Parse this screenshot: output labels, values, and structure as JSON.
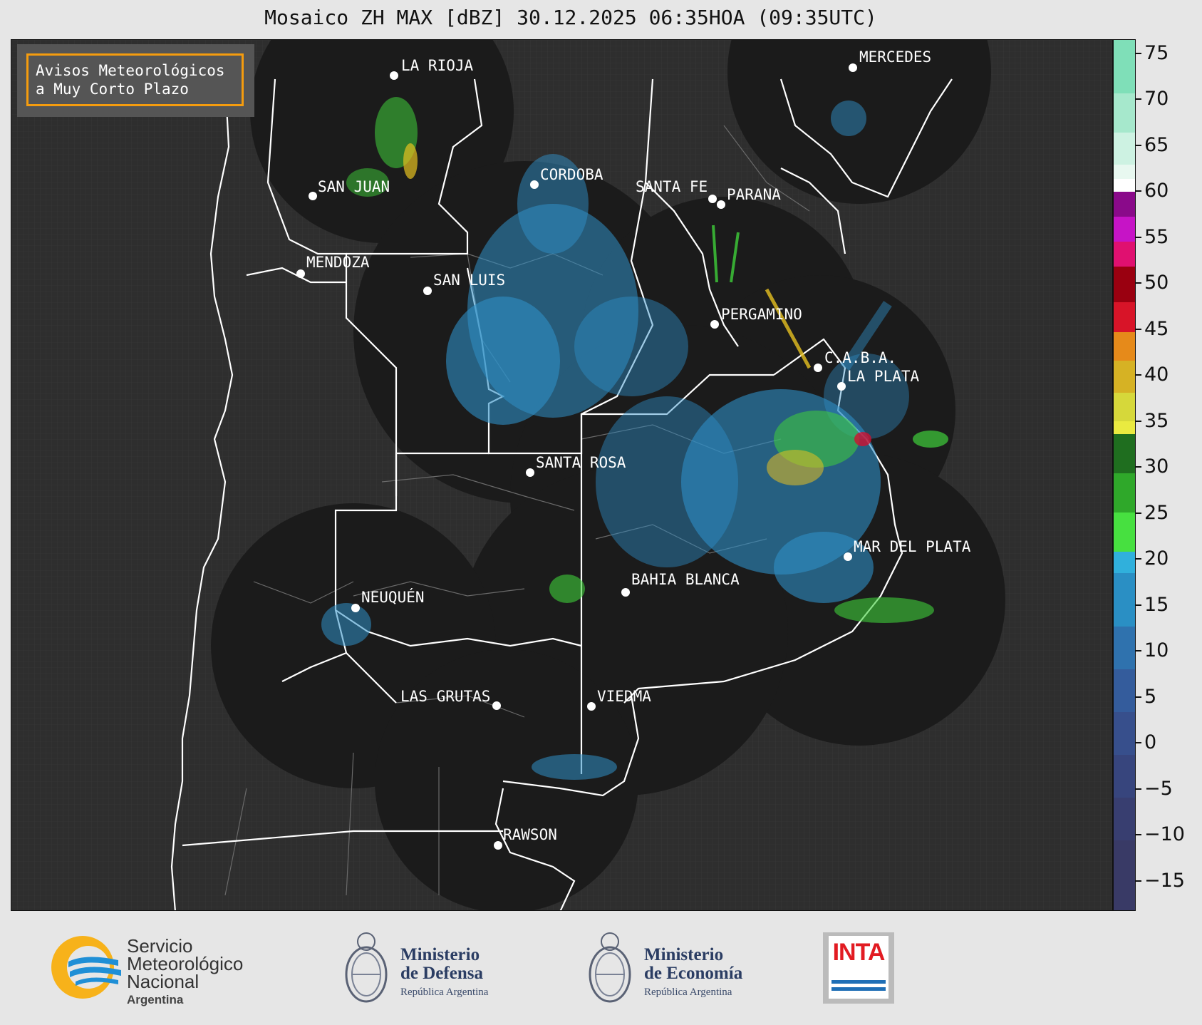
{
  "title": "Mosaico ZH MAX [dBZ] 30.12.2025 06:35HOA (09:35UTC)",
  "avisos": {
    "line1": "Avisos Meteorológicos",
    "line2": "a Muy Corto Plazo"
  },
  "cities": [
    {
      "name": "LA RIOJA"
    },
    {
      "name": "SAN JUAN"
    },
    {
      "name": "CORDOBA"
    },
    {
      "name": "SANTA FE"
    },
    {
      "name": "PARANA"
    },
    {
      "name": "MERCEDES"
    },
    {
      "name": "MENDOZA"
    },
    {
      "name": "SAN LUIS"
    },
    {
      "name": "PERGAMINO"
    },
    {
      "name": "C.A.B.A."
    },
    {
      "name": "LA PLATA"
    },
    {
      "name": "SANTA ROSA"
    },
    {
      "name": "MAR DEL PLATA"
    },
    {
      "name": "BAHIA BLANCA"
    },
    {
      "name": "NEUQUÉN"
    },
    {
      "name": "LAS GRUTAS"
    },
    {
      "name": "VIEDMA"
    },
    {
      "name": "RAWSON"
    }
  ],
  "colorbar": {
    "ticks": [
      "75",
      "70",
      "65",
      "60",
      "55",
      "50",
      "45",
      "40",
      "35",
      "30",
      "25",
      "20",
      "15",
      "10",
      "5",
      "0",
      "−5",
      "−10",
      "−15"
    ],
    "colors": {
      "map_background": "#2e2e2e",
      "radar_coverage": "#1b1b1b",
      "echo_low": "#2f8fc7",
      "echo_mid": "#3fcf3a",
      "echo_high": "#e6c020",
      "echo_max": "#d01030"
    }
  },
  "logos": {
    "smn": {
      "line1": "Servicio",
      "line2": "Meteorológico",
      "line3": "Nacional",
      "line4": "Argentina"
    },
    "defensa": {
      "line1": "Ministerio",
      "line2": "de Defensa",
      "line3": "República Argentina"
    },
    "economia": {
      "line1": "Ministerio",
      "line2": "de Economía",
      "line3": "República Argentina"
    },
    "inta": {
      "label": "INTA"
    }
  }
}
